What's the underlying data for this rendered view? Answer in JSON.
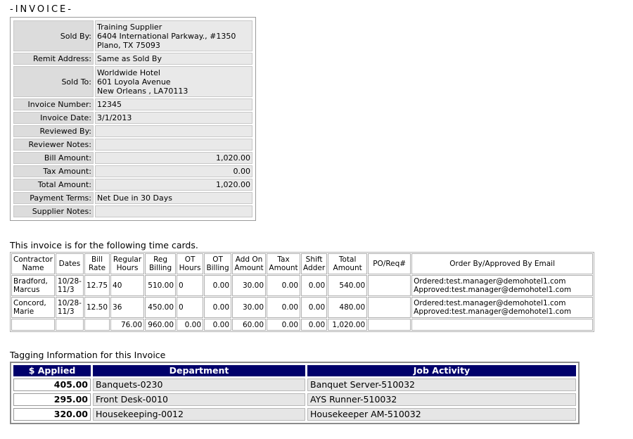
{
  "title": "-INVOICE-",
  "invoice": {
    "sold_by_label": "Sold By:",
    "sold_by": [
      "Training Supplier",
      "6404 International Parkway., #1350",
      "Plano, TX 75093"
    ],
    "remit_label": "Remit Address:",
    "remit": "Same as Sold By",
    "sold_to_label": "Sold To:",
    "sold_to": [
      "Worldwide Hotel",
      "601 Loyola Avenue",
      "New Orleans , LA70113"
    ],
    "number_label": "Invoice Number:",
    "number": "12345",
    "date_label": "Invoice Date:",
    "date": "3/1/2013",
    "reviewed_label": "Reviewed By:",
    "reviewed": "",
    "reviewer_notes_label": "Reviewer Notes:",
    "reviewer_notes": "",
    "bill_label": "Bill Amount:",
    "bill": "1,020.00",
    "tax_label": "Tax Amount:",
    "tax": "0.00",
    "total_label": "Total Amount:",
    "total": "1,020.00",
    "terms_label": "Payment Terms:",
    "terms": "Net Due in 30 Days",
    "supplier_notes_label": "Supplier Notes:",
    "supplier_notes": ""
  },
  "timecards": {
    "caption": "This invoice is for the following time cards.",
    "headers": [
      "Contractor\nName",
      "Dates",
      "Bill\nRate",
      "Regular\nHours",
      "Reg\nBilling",
      "OT\nHours",
      "OT\nBilling",
      "Add On\nAmount",
      "Tax\nAmount",
      "Shift\nAdder",
      "Total\nAmount",
      "PO/Req#",
      "Order By/Approved By Email"
    ],
    "rows": [
      {
        "name": "Bradford,\nMarcus",
        "dates": "10/28-\n11/3",
        "rate": "12.75",
        "reg_hours": "40",
        "reg_billing": "510.00",
        "ot_hours": "0",
        "ot_billing": "0.00",
        "addon": "30.00",
        "tax": "0.00",
        "shift": "0.00",
        "total": "540.00",
        "po": "",
        "email": "Ordered:test.manager@demohotel1.com\nApproved:test.manager@demohotel1.com"
      },
      {
        "name": "Concord,\nMarie",
        "dates": "10/28-\n11/3",
        "rate": "12.50",
        "reg_hours": "36",
        "reg_billing": "450.00",
        "ot_hours": "0",
        "ot_billing": "0.00",
        "addon": "30.00",
        "tax": "0.00",
        "shift": "0.00",
        "total": "480.00",
        "po": "",
        "email": "Ordered:test.manager@demohotel1.com\nApproved:test.manager@demohotel1.com"
      }
    ],
    "totals": {
      "reg_hours": "76.00",
      "reg_billing": "960.00",
      "ot_hours": "0.00",
      "ot_billing": "0.00",
      "addon": "60.00",
      "tax": "0.00",
      "shift": "0.00",
      "total": "1,020.00"
    }
  },
  "tagging": {
    "caption": "Tagging Information for this Invoice",
    "headers": [
      "$ Applied",
      "Department",
      "Job Activity"
    ],
    "rows": [
      {
        "amount": "405.00",
        "department": "Banquets-0230",
        "activity": "Banquet Server-510032"
      },
      {
        "amount": "295.00",
        "department": "Front Desk-0010",
        "activity": "AYS Runner-510032"
      },
      {
        "amount": "320.00",
        "department": "Housekeeping-0012",
        "activity": "Housekeeper AM-510032"
      }
    ]
  },
  "colors": {
    "header_bg": "#00006b",
    "label_bg": "#dcdcdc",
    "value_bg": "#e9e9e9"
  }
}
